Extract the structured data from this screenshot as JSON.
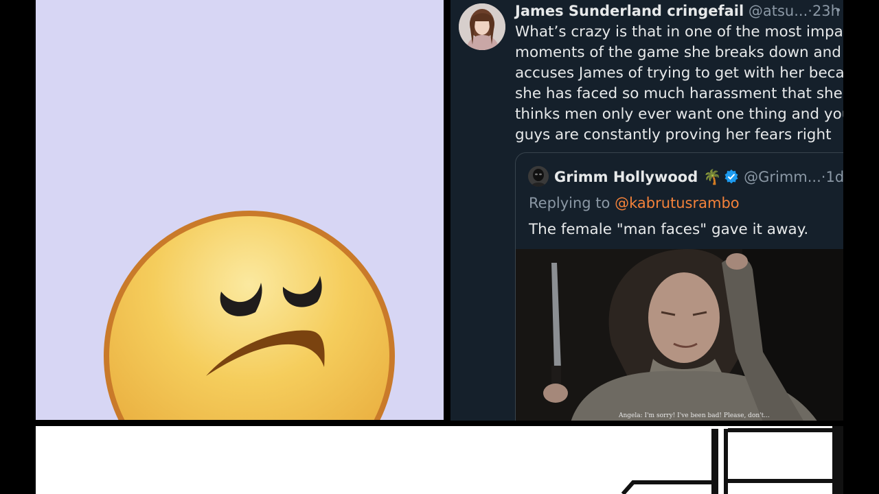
{
  "tweet": {
    "author_name": "James Sunderland cringefail",
    "handle": "@atsu...",
    "separator": "·",
    "time": "23h",
    "body_lines": [
      "What’s crazy is that in one of the most impactful",
      "moments of the game she breaks down and",
      "accuses James of trying to get with her because",
      "she has faced so much harassment that she",
      "thinks men only ever want one thing and you",
      "guys are constantly proving her fears right"
    ]
  },
  "quote": {
    "author_name": "Grimm Hollywood",
    "emoji": "🌴",
    "handle": "@Grimm...",
    "separator": "·",
    "time": "1d",
    "replying_prefix": "Replying to ",
    "replying_to": "@kabrutusrambo",
    "text": "The female \"man faces\" gave it away.",
    "image_caption": "Angela: I'm sorry! I've been bad! Please, don't..."
  },
  "icons": {
    "emoji_face": "disappointed-face-icon",
    "verified": "verified-badge-icon",
    "more": "more-options-icon"
  },
  "colors": {
    "left_background": "#d7d6f4",
    "tweet_background": "#15202b",
    "mention": "#f4823a",
    "verified": "#1d9bf0",
    "muted": "#8b98a5"
  }
}
